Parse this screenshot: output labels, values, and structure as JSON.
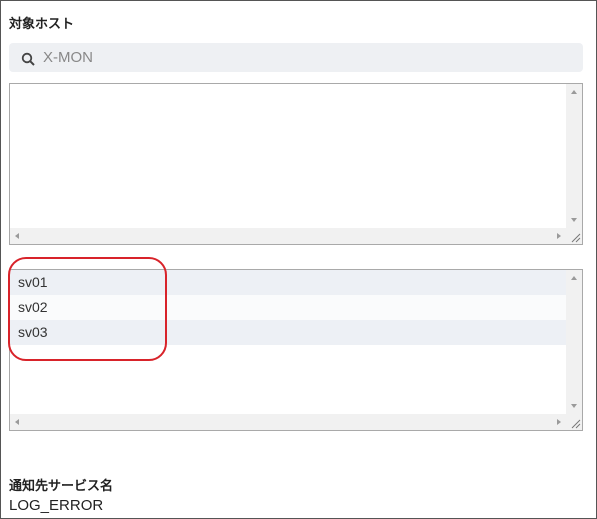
{
  "target_hosts": {
    "title": "対象ホスト",
    "search": {
      "placeholder": "X-MON",
      "icon": "search-icon"
    },
    "available_list": {
      "items": []
    },
    "selected_list": {
      "items": [
        "sv01",
        "sv02",
        "sv03"
      ]
    }
  },
  "notify_service": {
    "title": "通知先サービス名",
    "value": "LOG_ERROR"
  },
  "colors": {
    "highlight": "#d8232a",
    "row_odd": "#edf0f5",
    "row_even": "#fafbfc"
  }
}
